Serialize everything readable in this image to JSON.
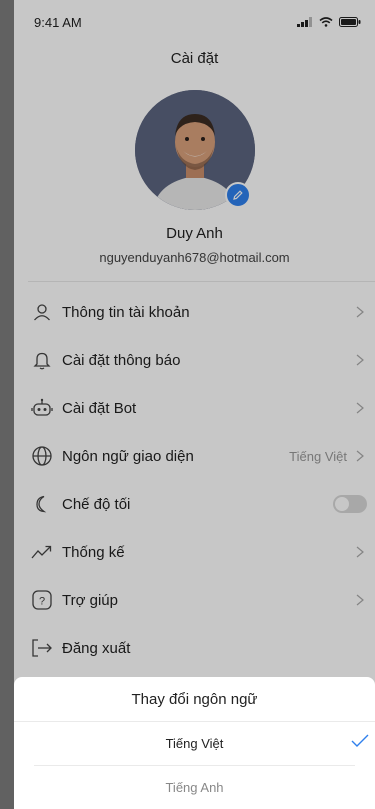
{
  "status_bar": {
    "time": "9:41 AM"
  },
  "page_title": "Cài đặt",
  "profile": {
    "name": "Duy Anh",
    "email": "nguyenduyanh678@hotmail.com"
  },
  "menu": {
    "items": [
      {
        "label": "Thông tin tài khoản",
        "icon": "user-icon"
      },
      {
        "label": "Cài đặt thông báo",
        "icon": "bell-icon"
      },
      {
        "label": "Cài đặt Bot",
        "icon": "robot-icon"
      },
      {
        "label": "Ngôn ngữ giao diện",
        "icon": "globe-icon",
        "value": "Tiếng Việt"
      },
      {
        "label": "Chế độ tối",
        "icon": "moon-icon",
        "toggle": false
      },
      {
        "label": "Thống kế",
        "icon": "trend-icon"
      },
      {
        "label": "Trợ giúp",
        "icon": "help-icon"
      },
      {
        "label": "Đăng xuất",
        "icon": "logout-icon"
      }
    ]
  },
  "language_sheet": {
    "title": "Thay đổi ngôn ngữ",
    "options": [
      {
        "label": "Tiếng Việt",
        "selected": true
      },
      {
        "label": "Tiếng Anh",
        "selected": false
      }
    ]
  },
  "colors": {
    "accent": "#2f80ed",
    "backdrop": "#7d7d7d"
  }
}
